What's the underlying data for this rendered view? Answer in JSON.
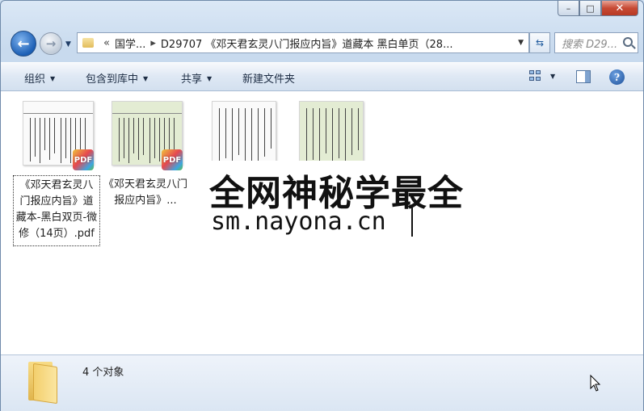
{
  "window": {
    "minimize_glyph": "–",
    "maximize_glyph": "□",
    "close_glyph": "✕"
  },
  "nav": {
    "back_glyph": "←",
    "forward_glyph": "→",
    "address": {
      "chevron": "«",
      "crumb1": "国学...",
      "crumb2": "D29707 《邓天君玄灵八门报应内旨》道藏本 黑白单页（28..."
    },
    "search_placeholder": "搜索 D29..."
  },
  "toolbar": {
    "organize": "组织",
    "include_library": "包含到库中",
    "share": "共享",
    "new_folder": "新建文件夹"
  },
  "files": [
    {
      "name": "《邓天君玄灵八门报应内旨》道藏本-黑白双页-微修（14页）.pdf",
      "badge": "PDF",
      "selected": true
    },
    {
      "name": "《邓天君玄灵八门报应内旨》...",
      "badge": "PDF",
      "selected": false
    },
    {
      "name": "",
      "badge": "",
      "selected": false
    },
    {
      "name": "",
      "badge": "",
      "selected": false
    }
  ],
  "watermark": {
    "line1": "全网神秘学最全",
    "line2": "sm.nayona.cn"
  },
  "details": {
    "count_text": "4 个对象"
  }
}
